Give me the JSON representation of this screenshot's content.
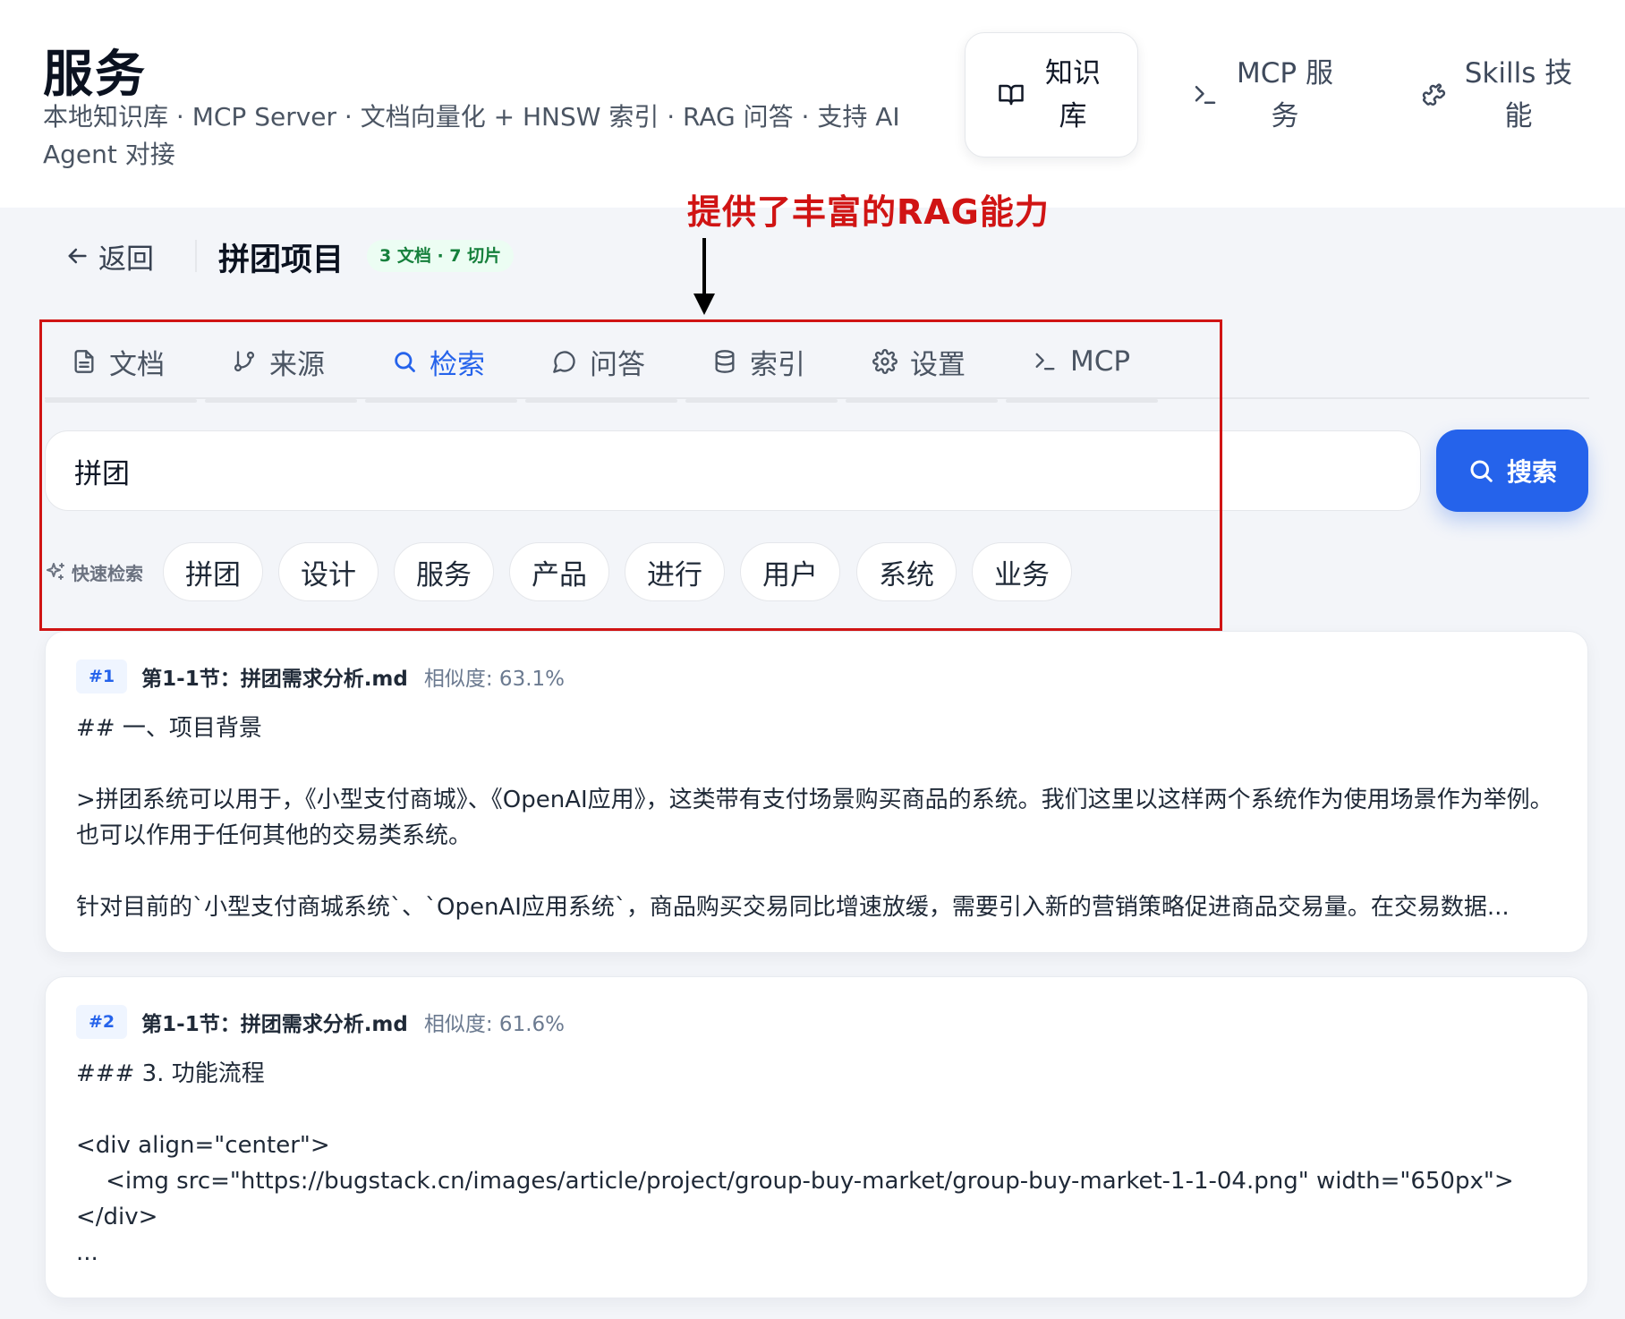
{
  "header": {
    "title": "服务",
    "subtitle": "本地知识库 · MCP Server · 文档向量化 + HNSW 索引 · RAG 问答 · 支持 AI Agent 对接",
    "nav": [
      {
        "label": "知识库",
        "icon": "book-icon",
        "active": true
      },
      {
        "label": "MCP 服务",
        "icon": "terminal-icon",
        "active": false
      },
      {
        "label": "Skills 技能",
        "icon": "puzzle-icon",
        "active": false
      }
    ]
  },
  "annotation": {
    "text": "提供了丰富的RAG能力",
    "color": "#d01414"
  },
  "breadcrumb": {
    "back_label": "返回",
    "project_title": "拼团项目",
    "badge": "3 文档 · 7 切片"
  },
  "tabs": [
    {
      "label": "文档",
      "icon": "file-icon",
      "active": false
    },
    {
      "label": "来源",
      "icon": "git-branch-icon",
      "active": false
    },
    {
      "label": "检索",
      "icon": "search-icon",
      "active": true
    },
    {
      "label": "问答",
      "icon": "chat-bubble-icon",
      "active": false
    },
    {
      "label": "索引",
      "icon": "database-icon",
      "active": false
    },
    {
      "label": "设置",
      "icon": "gear-icon",
      "active": false
    },
    {
      "label": "MCP",
      "icon": "terminal-icon",
      "active": false
    }
  ],
  "search": {
    "value": "拼团",
    "button_label": "搜索"
  },
  "quick_search": {
    "label": "快速检索",
    "chips": [
      "拼团",
      "设计",
      "服务",
      "产品",
      "进行",
      "用户",
      "系统",
      "业务"
    ]
  },
  "results": [
    {
      "rank": "#1",
      "source": "第1-1节：拼团需求分析.md",
      "similarity": "相似度: 63.1%",
      "content": "## 一、项目背景\n\n>拼团系统可以用于，《小型支付商城》、《OpenAI应用》，这类带有支付场景购买商品的系统。我们这里以这样两个系统作为使用场景作为举例。也可以作用于任何其他的交易类系统。\n\n针对目前的`小型支付商城系统`、`OpenAI应用系统`，商品购买交易同比增速放缓，需要引入新的营销策略促进商品交易量。在交易数据..."
    },
    {
      "rank": "#2",
      "source": "第1-1节：拼团需求分析.md",
      "similarity": "相似度: 61.6%",
      "content": "### 3. 功能流程\n\n<div align=\"center\">\n    <img src=\"https://bugstack.cn/images/article/project/group-buy-market/group-buy-market-1-1-04.png\" width=\"650px\">\n</div>\n..."
    }
  ],
  "colors": {
    "accent": "#2563eb",
    "badge_green": "#16803c",
    "annotation_red": "#d01414"
  }
}
